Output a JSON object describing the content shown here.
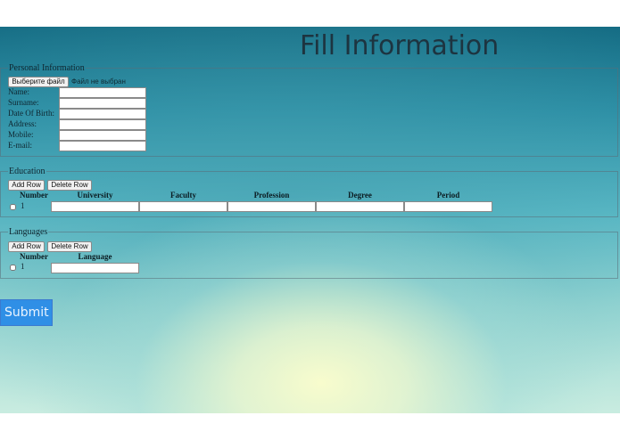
{
  "page": {
    "title": "Fill Information",
    "submit_label": "Submit"
  },
  "personal": {
    "legend": "Personal Information",
    "file_button_label": "Выберите файл",
    "file_status": "Файл не выбран",
    "fields": [
      {
        "label": "Name:",
        "value": ""
      },
      {
        "label": "Surname:",
        "value": ""
      },
      {
        "label": "Date Of Birth:",
        "value": ""
      },
      {
        "label": "Address:",
        "value": ""
      },
      {
        "label": "Mobile:",
        "value": ""
      },
      {
        "label": "E-mail:",
        "value": ""
      }
    ]
  },
  "education": {
    "legend": "Education",
    "add_row_label": "Add Row",
    "delete_row_label": "Delete Row",
    "columns": [
      "Number",
      "University",
      "Faculty",
      "Profession",
      "Degree",
      "Period"
    ],
    "rows": [
      {
        "number": "1",
        "checked": false,
        "values": [
          "",
          "",
          "",
          "",
          ""
        ]
      }
    ]
  },
  "languages": {
    "legend": "Languages",
    "add_row_label": "Add Row",
    "delete_row_label": "Delete Row",
    "columns": [
      "Number",
      "Language"
    ],
    "rows": [
      {
        "number": "1",
        "checked": false,
        "values": [
          ""
        ]
      }
    ]
  },
  "colors": {
    "submit_bg": "#2f8fe6",
    "title_text": "#1d3440"
  }
}
